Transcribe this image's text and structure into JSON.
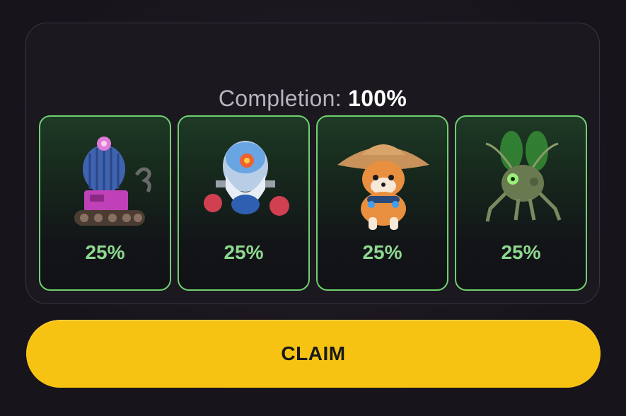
{
  "completion": {
    "label": "Completion:",
    "value": "100%"
  },
  "cards": [
    {
      "name": "cactus-tank-icon",
      "percent": "25%"
    },
    {
      "name": "boxing-robot-icon",
      "percent": "25%"
    },
    {
      "name": "shiba-dog-icon",
      "percent": "25%"
    },
    {
      "name": "mech-bug-icon",
      "percent": "25%"
    }
  ],
  "claim_button": {
    "label": "CLAIM"
  },
  "colors": {
    "background": "#1a161d",
    "card_border": "#6fd06f",
    "percent_text": "#8fd88f",
    "claim_button": "#f7c313"
  }
}
